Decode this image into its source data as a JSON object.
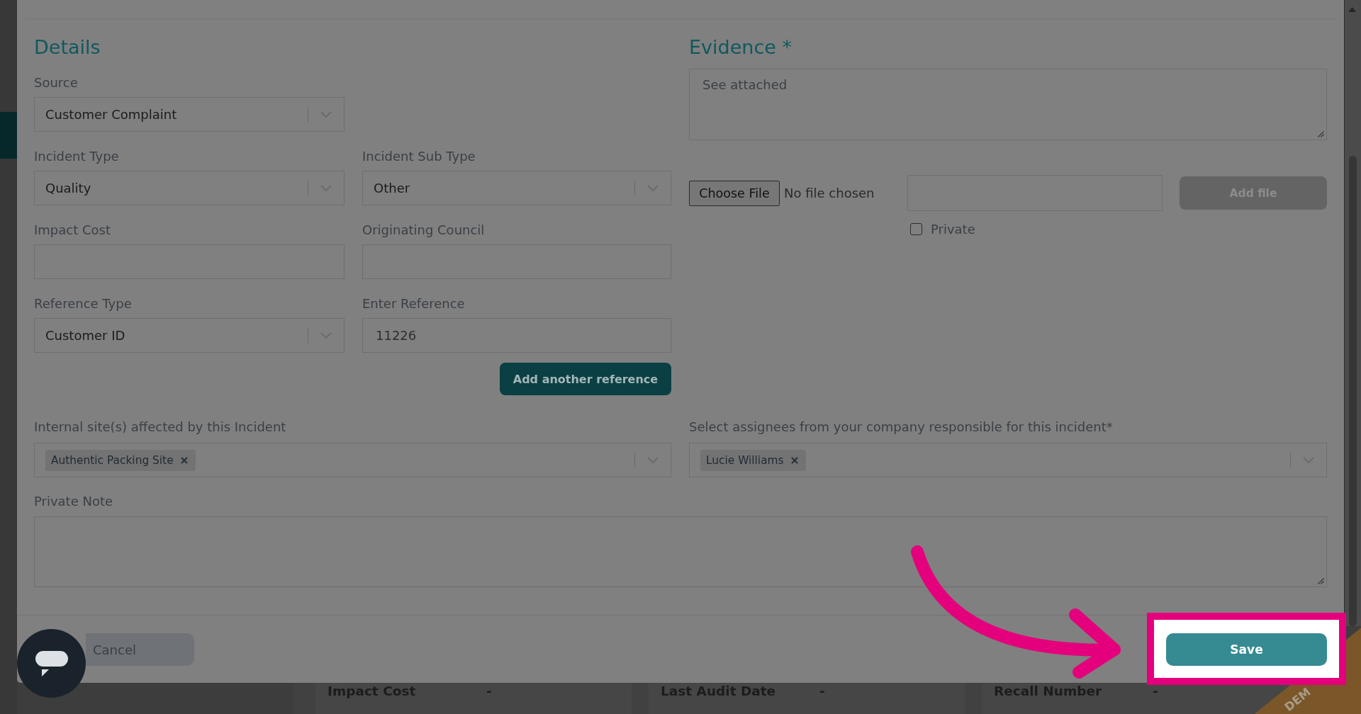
{
  "page": {
    "details": [
      {
        "label": "Impact Cost",
        "value": "-"
      },
      {
        "label": "Last Audit Date",
        "value": "-"
      },
      {
        "label": "Recall Number",
        "value": "-"
      }
    ],
    "ribbon": {
      "text": "DEM"
    }
  },
  "modal": {
    "details": {
      "title": "Details",
      "rows": [
        [
          {
            "kind": "select",
            "label": "Source",
            "value": "Customer Complaint"
          }
        ],
        [
          {
            "kind": "select",
            "label": "Incident Type",
            "value": "Quality"
          },
          {
            "kind": "select",
            "label": "Incident Sub Type",
            "value": "Other"
          }
        ],
        [
          {
            "kind": "text",
            "label": "Impact Cost"
          },
          {
            "kind": "text",
            "label": "Originating Council"
          }
        ],
        [
          {
            "kind": "select",
            "label": "Reference Type",
            "value": "Customer ID"
          },
          {
            "kind": "text",
            "label": "Enter Reference",
            "value": "11226"
          }
        ]
      ],
      "add_button": "Add another reference"
    },
    "evidence": {
      "title": "Evidence *",
      "text": "See attached",
      "choose_file": "Choose File",
      "file_status": "No file chosen",
      "add_file": {
        "label": "Add file",
        "disabled": true
      },
      "private": {
        "label": "Private",
        "checked": false
      }
    },
    "sites": {
      "label": "Internal site(s) affected by this Incident",
      "chips": [
        "Authentic Packing Site"
      ]
    },
    "assignees": {
      "label": "Select assignees from your company responsible for this incident*",
      "chips": [
        "Lucie Williams"
      ]
    },
    "private_note": {
      "label": "Private Note"
    },
    "footer": {
      "cancel": "Cancel",
      "save": {
        "label": "Save",
        "highlighted": true
      }
    }
  }
}
